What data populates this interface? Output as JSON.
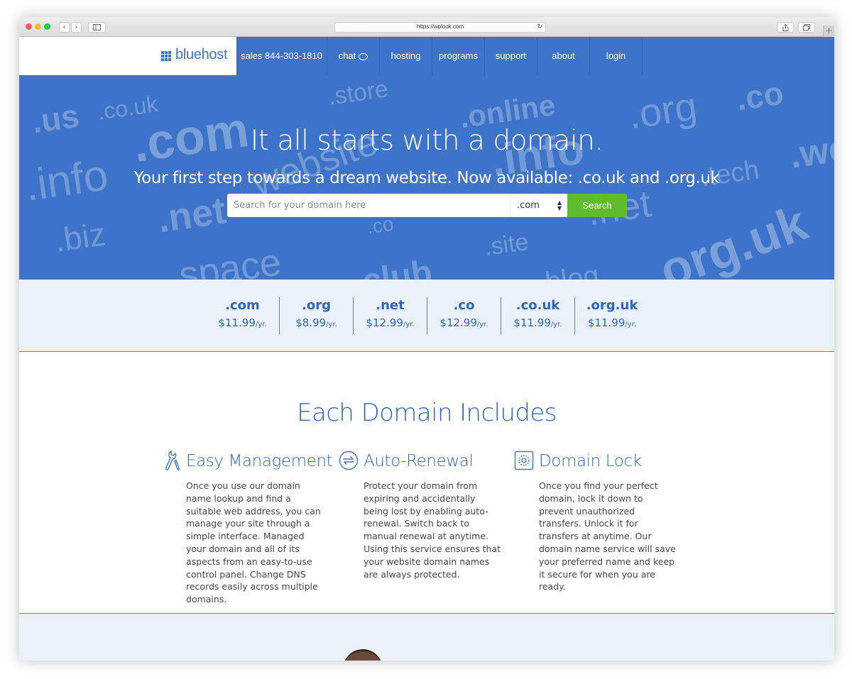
{
  "browser": {
    "url": "https://wplook.com",
    "back_glyph": "‹",
    "forward_glyph": "›",
    "reload_glyph": "↻",
    "new_tab_glyph": "+"
  },
  "site": {
    "brand": "bluehost",
    "brand_color": "#3d73c8",
    "accent_green": "#5ebc2d",
    "nav": [
      {
        "label": "sales 844-303-1810",
        "width": 128
      },
      {
        "label": "chat",
        "width": 74
      },
      {
        "label": "hosting",
        "width": 74
      },
      {
        "label": "programs",
        "width": 74
      },
      {
        "label": "support",
        "width": 74
      },
      {
        "label": "about",
        "width": 74
      },
      {
        "label": "login",
        "width": 74
      }
    ]
  },
  "hero": {
    "title": "It all starts with a domain.",
    "subtitle": "Your first step towards a dream website. Now available: .co.uk and .org.uk",
    "search_placeholder": "Search for your domain here",
    "selected_tld": ".com",
    "search_label": "Search",
    "background_tlds": [
      ".us",
      ".co.uk",
      ".com",
      ".store",
      ".online",
      ".org",
      ".co",
      ".info",
      "website",
      ".info",
      ".tech",
      ".web",
      ".biz",
      ".net",
      ".co",
      ".site",
      ".net",
      ".org.uk",
      "space",
      ".club",
      ".blog"
    ]
  },
  "pricing": [
    {
      "tld": ".com",
      "price": "$11.99",
      "unit": "/yr."
    },
    {
      "tld": ".org",
      "price": "$8.99",
      "unit": "/yr."
    },
    {
      "tld": ".net",
      "price": "$12.99",
      "unit": "/yr."
    },
    {
      "tld": ".co",
      "price": "$12.99",
      "unit": "/yr."
    },
    {
      "tld": ".co.uk",
      "price": "$11.99",
      "unit": "/yr."
    },
    {
      "tld": ".org.uk",
      "price": "$11.99",
      "unit": "/yr."
    }
  ],
  "features": {
    "title": "Each Domain Includes",
    "items": [
      {
        "icon": "wrench-screwdriver-icon",
        "heading": "Easy Management",
        "body": "Once you use our domain name lookup and find a suitable web address, you can manage your site through a simple interface. Managed your domain and all of its aspects from an easy-to-use control panel. Change DNS records easily across multiple domains."
      },
      {
        "icon": "renew-arrows-icon",
        "heading": "Auto-Renewal",
        "body": "Protect your domain from expiring and accidentally being lost by enabling auto-renewal. Switch back to manual renewal at anytime. Using this service ensures that your website domain names are always protected."
      },
      {
        "icon": "lock-dial-icon",
        "heading": "Domain Lock",
        "body": "Once you find your perfect domain, lock it down to prevent unauthorized transfers. Unlock it for transfers at anytime. Our domain name service will save your preferred name and keep it secure for when you are ready."
      }
    ]
  }
}
